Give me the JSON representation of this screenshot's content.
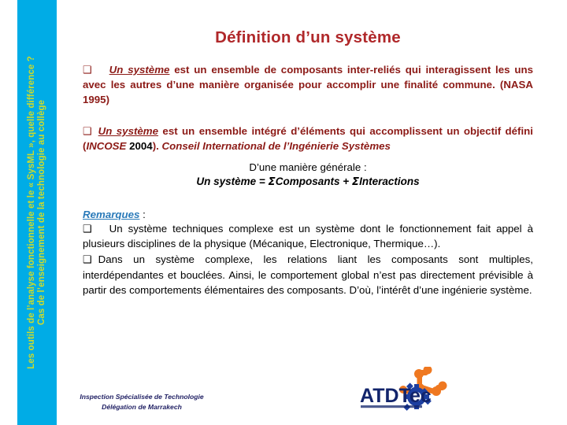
{
  "side_band": {
    "background_color": "#00ace6",
    "text_color": "#cddb2b",
    "line1": "Les outils de l’analyse fonctionnelle et le « SysML », quelle différence ?",
    "line2": "Cas de l’enseignement de la technologie au collège"
  },
  "slide": {
    "title": "Définition d’un système",
    "title_color": "#b0282a",
    "body_red": "#8c1a16",
    "accent_blue": "#2a7ab9"
  },
  "bullets": {
    "marker": "❑",
    "b1": {
      "lead": "Un système",
      "rest": " est un ensemble de composants inter-reliés qui interagissent les uns avec les autres d’une manière organisée pour accomplir une finalité commune. (NASA 1995)"
    },
    "b2": {
      "lead": "Un système",
      "part1": " est un ensemble intégré d’éléments qui accomplissent un objectif défini (",
      "source": "INCOSE",
      "year": " 2004",
      "part2": "). ",
      "expansion": "Conseil International de l’Ingénierie Systèmes"
    }
  },
  "general": {
    "intro": "D’une manière générale :",
    "formula_prefix": "Un système = ",
    "sigma": "Σ",
    "formula_mid": "Composants + ",
    "formula_suffix": "Interactions"
  },
  "remarks": {
    "heading_word": "Remarques",
    "heading_colon": " :",
    "n1": "Un système techniques complexe est un système dont le fonctionnement fait appel à plusieurs disciplines de la physique (Mécanique, Electronique, Thermique…).",
    "n2": "Dans un système complexe, les relations liant les composants sont multiples, interdépendantes et bouclées. Ainsi, le comportement global n’est pas directement prévisible à partir des comportements élémentaires des composants. D’où, l’intérêt d’une ingénierie système."
  },
  "footer": {
    "line1": "Inspection Spécialisée de Technologie",
    "line2": "Délégation de Marrakech",
    "color": "#1f1f63"
  },
  "logo": {
    "wordmark": "ATDTec",
    "wordmark_color": "#12246b",
    "accent_orange": "#ef7820",
    "accent_blue": "#1d3fa0"
  }
}
